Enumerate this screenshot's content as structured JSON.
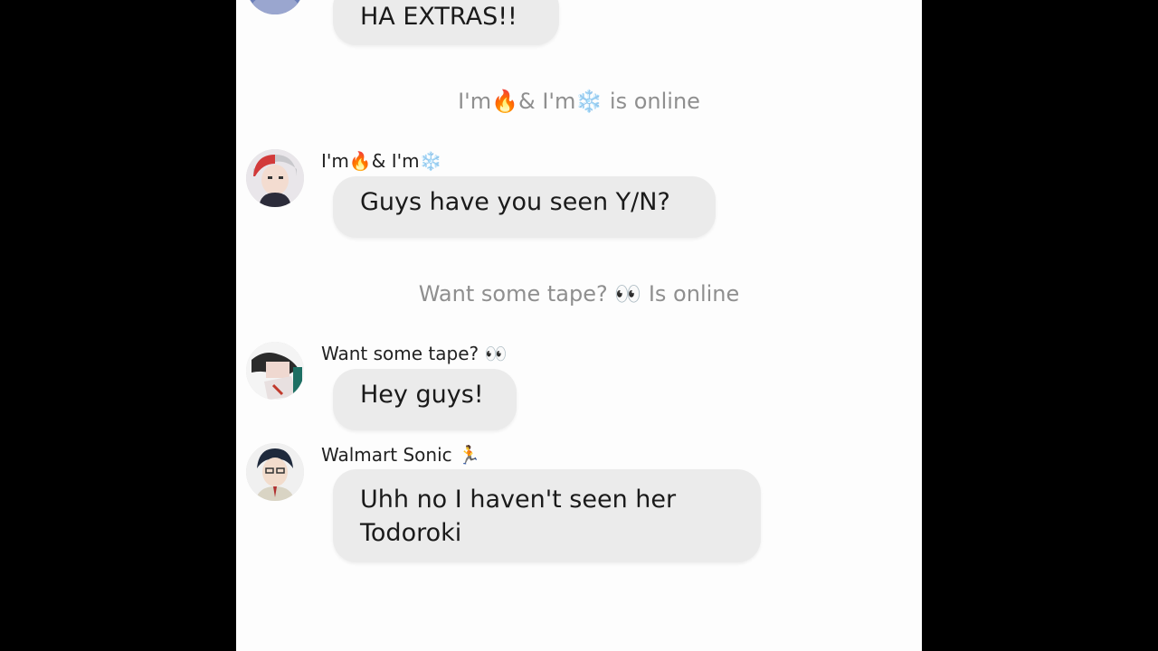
{
  "messages": {
    "m0": {
      "text": "HA EXTRAS!!"
    },
    "status1": {
      "text": "I'm🔥& I'm❄️ is online"
    },
    "m1": {
      "sender": "I'm🔥& I'm❄️",
      "text": "Guys have you seen Y/N?"
    },
    "status2": {
      "text": "Want some tape? 👀 Is online"
    },
    "m2": {
      "sender": "Want some tape? 👀",
      "text": "Hey guys!"
    },
    "m3": {
      "sender": "Walmart Sonic 🏃",
      "text": "Uhh no I haven't seen her Todoroki"
    }
  },
  "colors": {
    "background": "#000000",
    "chat_background": "#fdfdfd",
    "bubble": "#ebebeb",
    "status_text": "#8f8f8f"
  }
}
